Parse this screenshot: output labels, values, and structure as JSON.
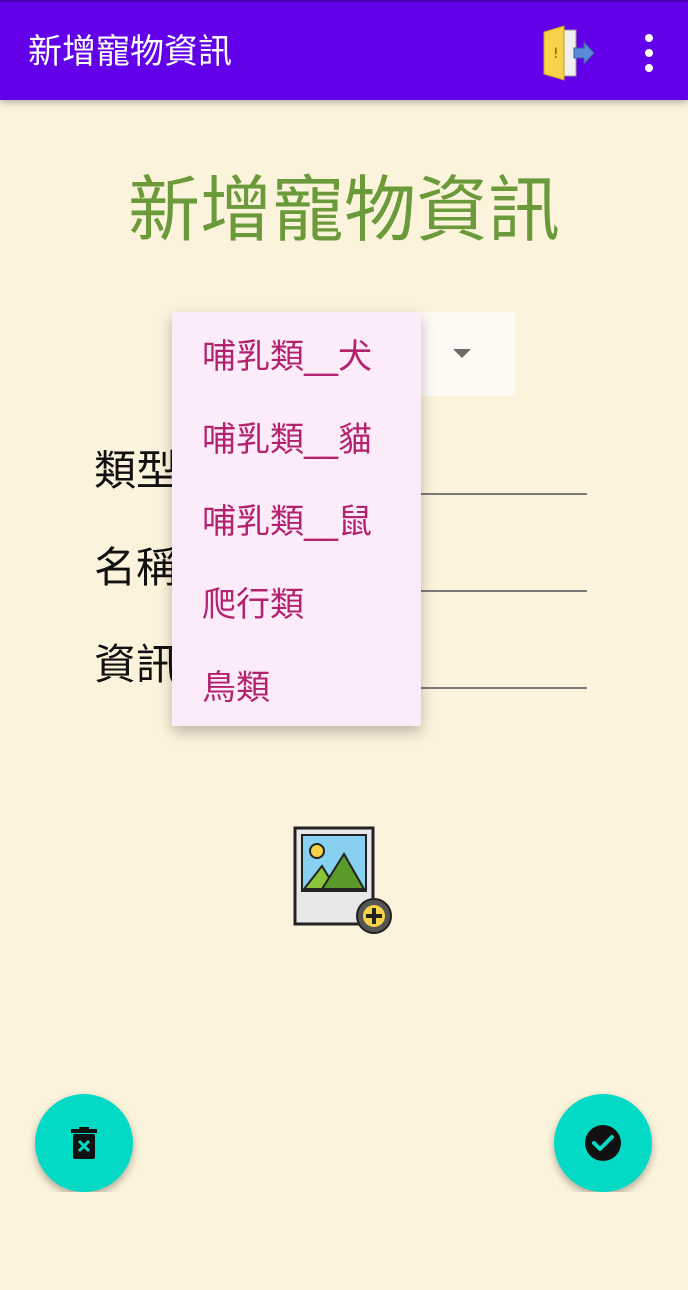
{
  "appbar": {
    "title": "新增寵物資訊",
    "exit_icon": "exit-door-icon",
    "overflow_icon": "more-vert-icon",
    "color": "#6200ea"
  },
  "form": {
    "heading": "新增寵物資訊",
    "heading_color": "#6a9a3a",
    "type_label": "類型",
    "name_label": "名稱",
    "info_label": "資訊"
  },
  "spinner": {
    "options": [
      "哺乳類__犬",
      "哺乳類__貓",
      "哺乳類__鼠",
      "爬行類",
      "鳥類"
    ],
    "option_color": "#b3226e"
  },
  "actions": {
    "image_picker_icon": "add-image-icon",
    "delete_icon": "delete-icon",
    "confirm_icon": "check-circle-icon",
    "fab_color": "#03dac5"
  }
}
